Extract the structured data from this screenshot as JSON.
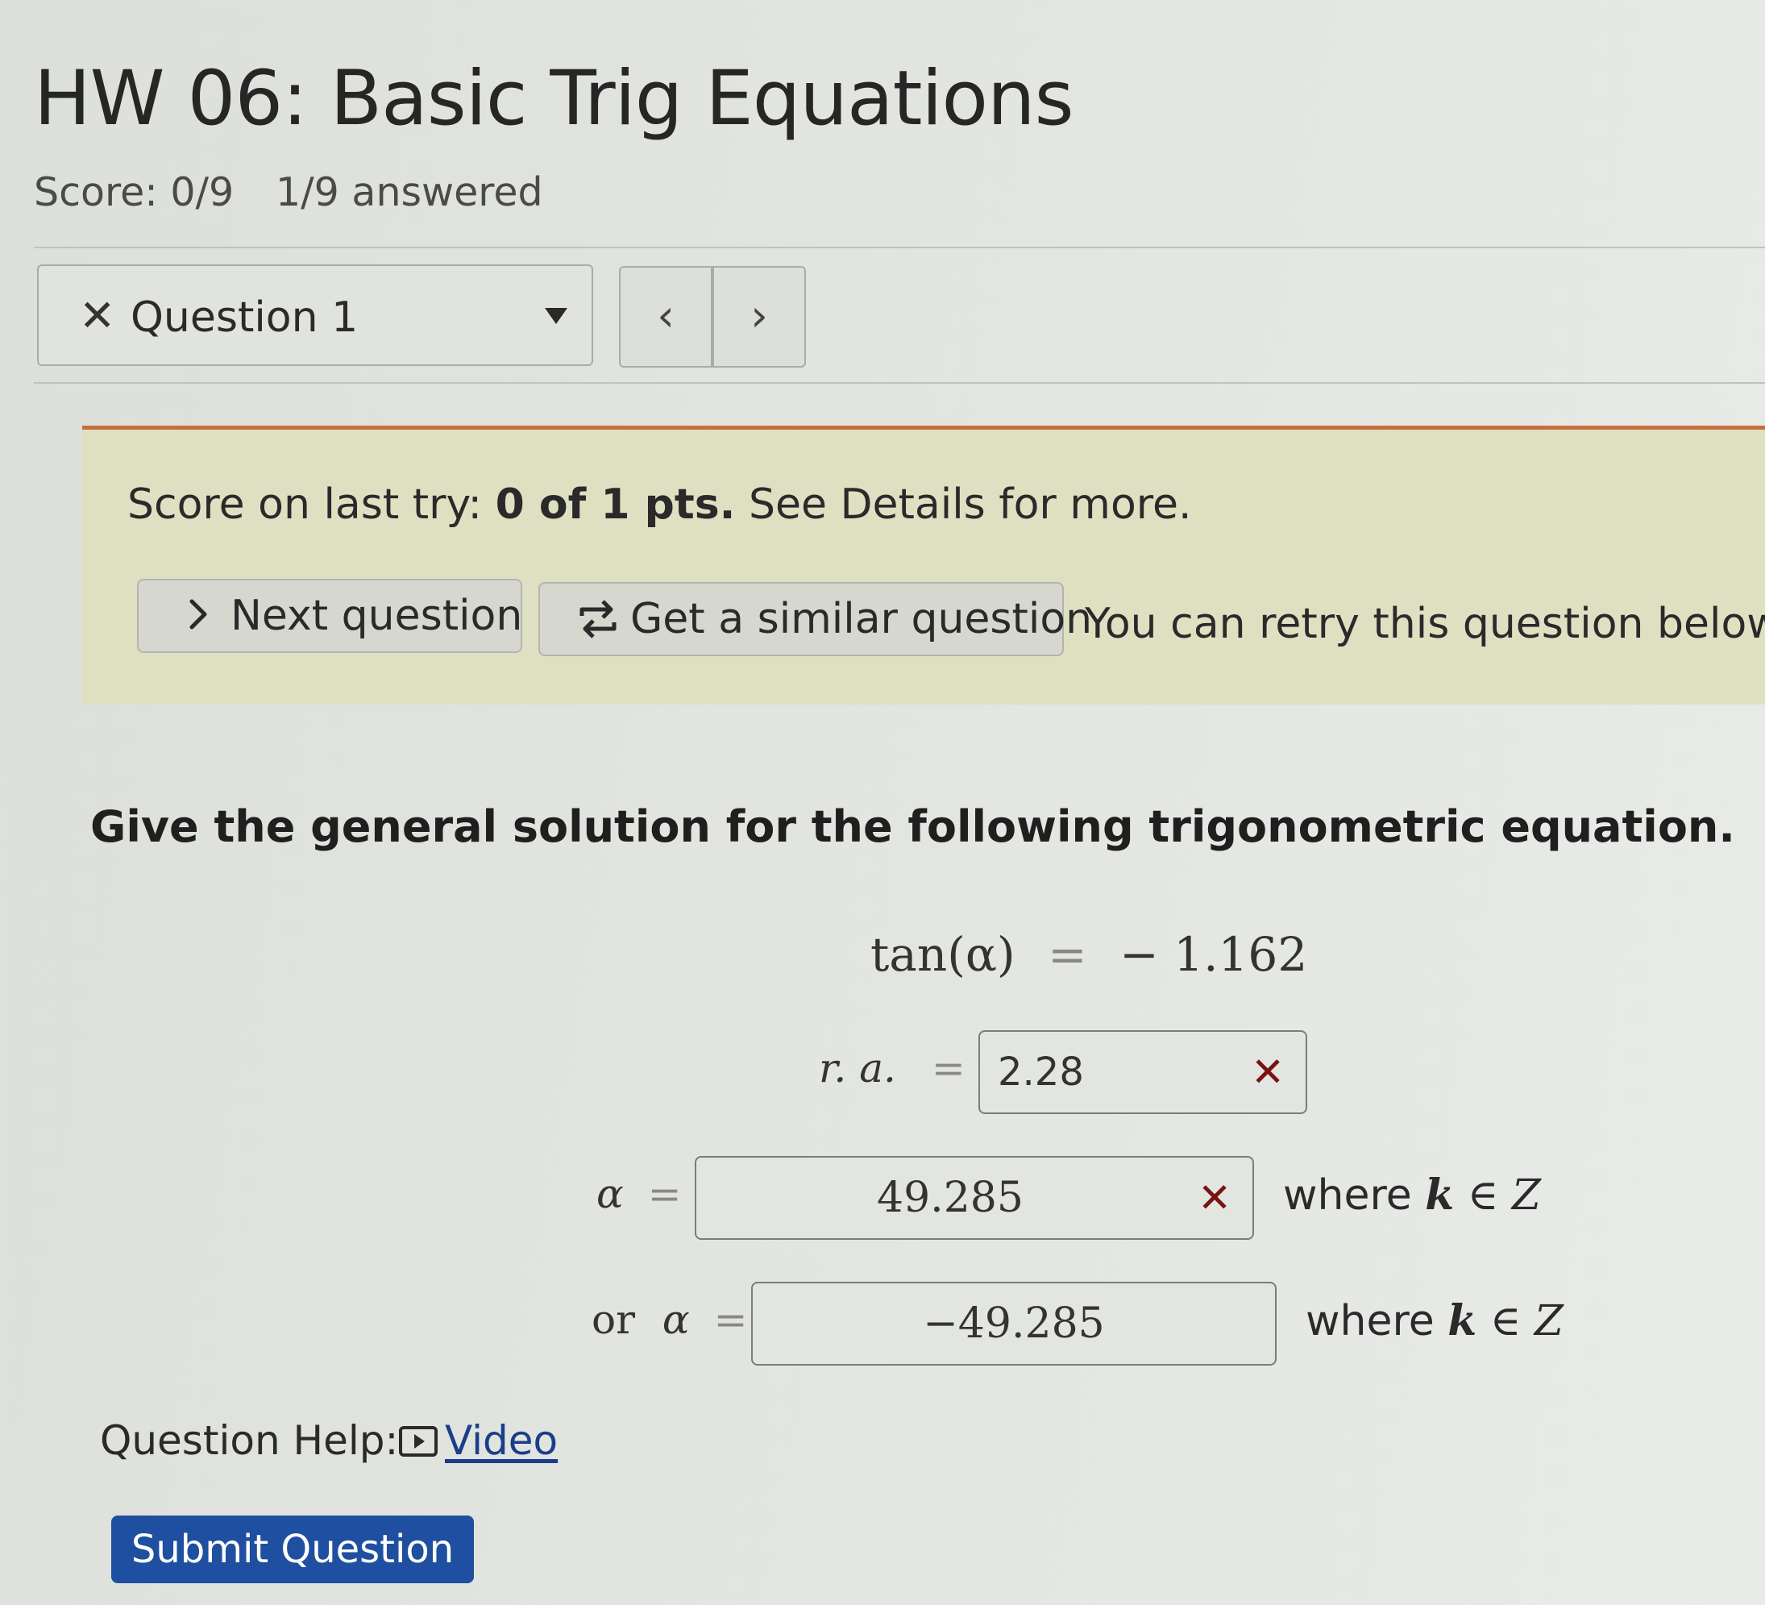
{
  "header": {
    "title": "HW 06: Basic Trig Equations",
    "score": "Score: 0/9",
    "answered": "1/9 answered"
  },
  "question_nav": {
    "current": "Question 1",
    "status_icon": "close-icon",
    "prev_icon": "chevron-left-icon",
    "next_icon": "chevron-right-icon"
  },
  "feedback": {
    "prefix": "Score on last try: ",
    "points": "0 of 1 pts.",
    "suffix": " See Details for more.",
    "next_button": "Next question",
    "similar_button": "Get a similar question",
    "retry_note": "You can retry this question below",
    "banner_color": "#dfe0c2",
    "accent_color": "#c5703c"
  },
  "problem": {
    "prompt": "Give the general solution for the following trigonometric equation.",
    "equation_lhs": "tan(α)",
    "equation_eq": "=",
    "equation_rhs": "− 1.162",
    "ra_label": "r. a.",
    "eq_sign": "=",
    "ra_value": "2.28",
    "ra_status": "incorrect",
    "alpha1_label": "α",
    "alpha1_value": "49.285",
    "alpha1_status": "incorrect",
    "alpha2_or": "or",
    "alpha2_label": "α",
    "alpha2_value": "−49.285",
    "where_text": "where",
    "where_var": "k",
    "where_set": "∈ Z",
    "wrong_mark": "✕"
  },
  "help": {
    "label": "Question Help:",
    "video": "Video",
    "video_icon": "play-icon"
  },
  "submit": {
    "label": "Submit Question",
    "color": "#1f4fa0"
  }
}
